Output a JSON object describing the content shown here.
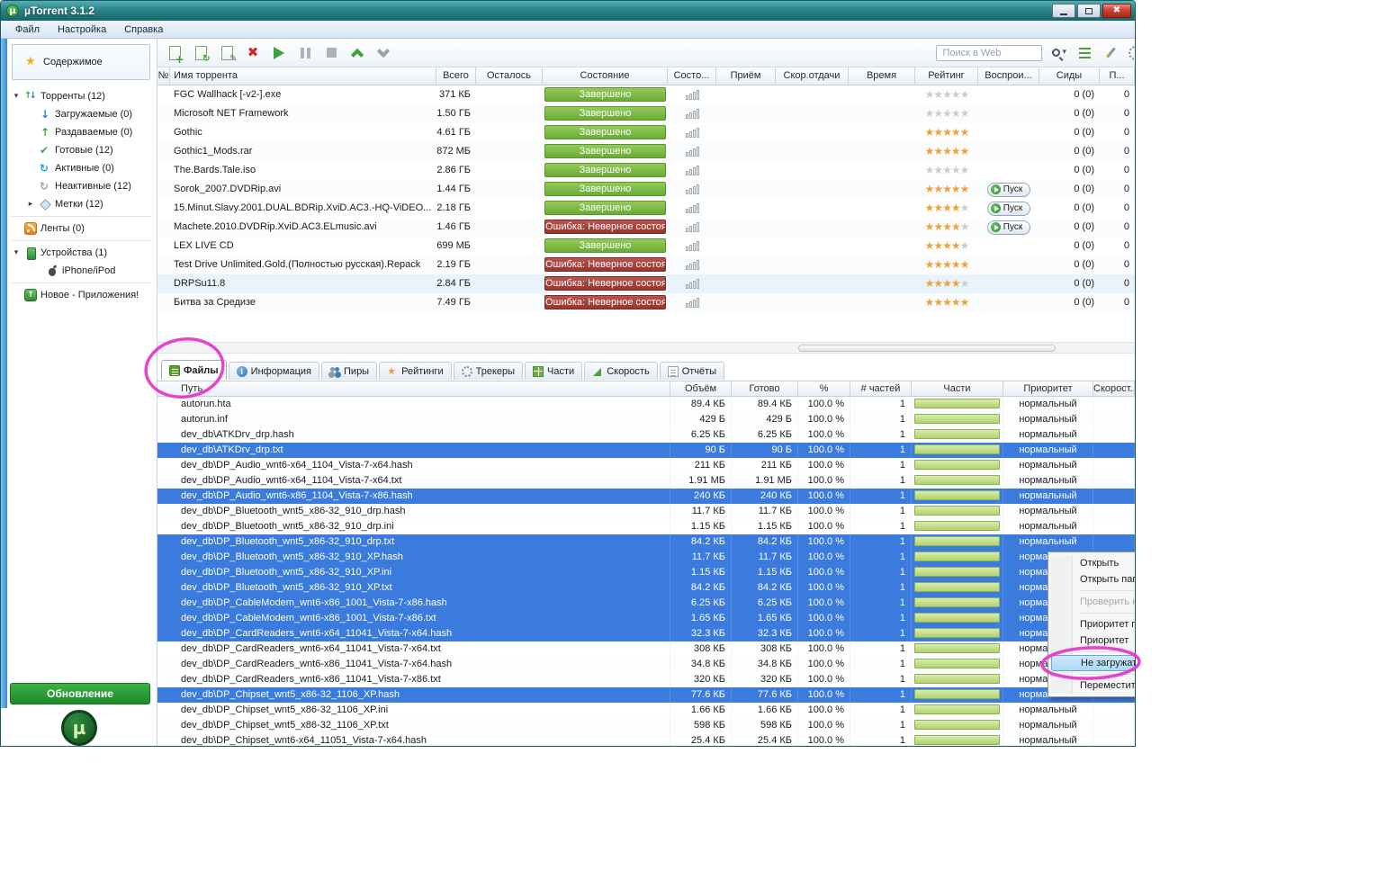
{
  "titlebar": {
    "title": "µTorrent 3.1.2"
  },
  "menubar": {
    "items": [
      {
        "key": "file",
        "label": "Файл"
      },
      {
        "key": "settings",
        "label": "Настройка"
      },
      {
        "key": "help",
        "label": "Справка"
      }
    ]
  },
  "toolbar": {
    "search_placeholder": "Поиск в Web"
  },
  "sidebar": {
    "content_label": "Содержимое",
    "update_button": "Обновление",
    "plus_logo_glyph": "µ",
    "items": [
      {
        "key": "torrents",
        "label": "Торренты (12)",
        "icon": "torrents-icon",
        "indent": 0,
        "expander": "expanded"
      },
      {
        "key": "downloading",
        "label": "Загружаемые (0)",
        "icon": "download-arrow-icon",
        "indent": 1
      },
      {
        "key": "seeding",
        "label": "Раздаваемые (0)",
        "icon": "upload-arrow-icon",
        "indent": 1
      },
      {
        "key": "finished",
        "label": "Готовые (12)",
        "icon": "check-icon",
        "indent": 1
      },
      {
        "key": "active",
        "label": "Активные (0)",
        "icon": "active-arrows-icon",
        "indent": 1
      },
      {
        "key": "inactive",
        "label": "Неактивные (12)",
        "icon": "inactive-arrows-icon",
        "indent": 1
      },
      {
        "key": "labels",
        "label": "Метки (12)",
        "icon": "label-icon",
        "indent": 1,
        "expander": "collapsed"
      },
      {
        "divider": true
      },
      {
        "key": "feeds",
        "label": "Ленты (0)",
        "icon": "rss-icon",
        "indent": 0
      },
      {
        "divider": true
      },
      {
        "key": "devices",
        "label": "Устройства (1)",
        "icon": "device-icon",
        "indent": 0,
        "expander": "expanded"
      },
      {
        "key": "iphone",
        "label": "iPhone/iPod",
        "icon": "apple-icon",
        "indent": 2
      },
      {
        "divider": true
      },
      {
        "key": "apps-promo",
        "label": "Новое - Приложения!",
        "icon": "apps-icon",
        "indent": 0
      }
    ]
  },
  "torrent_table": {
    "columns": [
      "№",
      "Имя торрента",
      "Всего",
      "Осталось",
      "Состояние",
      "Состо...",
      "Приём",
      "Скор.отдачи",
      "Время",
      "Рейтинг",
      "Воспрои...",
      "Сиды",
      "П..."
    ],
    "play_label": "Пуск",
    "rows": [
      {
        "name": "FGC Wallhack [-v2-].exe",
        "size": "371 КБ",
        "status": "Завершено",
        "status_type": "done",
        "rating": 0,
        "play": false,
        "seeds": "0 (0)",
        "p": "0"
      },
      {
        "name": "Microsoft NET Framework",
        "size": "1.50 ГБ",
        "status": "Завершено",
        "status_type": "done",
        "rating": 0,
        "play": false,
        "seeds": "0 (0)",
        "p": "0"
      },
      {
        "name": "Gothic",
        "size": "4.61 ГБ",
        "status": "Завершено",
        "status_type": "done",
        "rating": 5,
        "play": false,
        "seeds": "0 (0)",
        "p": "0"
      },
      {
        "name": "Gothic1_Mods.rar",
        "size": "872 МБ",
        "status": "Завершено",
        "status_type": "done",
        "rating": 5,
        "play": false,
        "seeds": "0 (0)",
        "p": "0"
      },
      {
        "name": "The.Bards.Tale.iso",
        "size": "2.86 ГБ",
        "status": "Завершено",
        "status_type": "done",
        "rating": 0,
        "play": false,
        "seeds": "0 (0)",
        "p": "0"
      },
      {
        "name": "Sorok_2007.DVDRip.avi",
        "size": "1.44 ГБ",
        "status": "Завершено",
        "status_type": "done",
        "rating": 5,
        "play": true,
        "seeds": "0 (0)",
        "p": "0"
      },
      {
        "name": "15.Minut.Slavy.2001.DUAL.BDRip.XviD.AC3.-HQ-ViDEO...",
        "size": "2.18 ГБ",
        "status": "Завершено",
        "status_type": "done",
        "rating": 4,
        "play": true,
        "seeds": "0 (0)",
        "p": "0"
      },
      {
        "name": "Machete.2010.DVDRip.XviD.AC3.ELmusic.avi",
        "size": "1.46 ГБ",
        "status": "Ошибка: Неверное состоя",
        "status_type": "error",
        "rating": 4,
        "play": true,
        "seeds": "0 (0)",
        "p": "0"
      },
      {
        "name": "LEX LIVE CD",
        "size": "699 МБ",
        "status": "Завершено",
        "status_type": "done",
        "rating": 4,
        "play": false,
        "seeds": "0 (0)",
        "p": "0"
      },
      {
        "name": "Test Drive Unlimited.Gold.(Полностью русская).Repack",
        "size": "2.19 ГБ",
        "status": "Ошибка: Неверное состоя",
        "status_type": "error",
        "rating": 5,
        "play": false,
        "seeds": "0 (0)",
        "p": "0"
      },
      {
        "name": "DRPSu11.8",
        "size": "2.84 ГБ",
        "status": "Ошибка: Неверное состоя",
        "status_type": "error",
        "rating": 4,
        "play": false,
        "seeds": "0 (0)",
        "p": "0",
        "hover": true
      },
      {
        "name": "Битва за Средизе",
        "size": "7.49 ГБ",
        "status": "Ошибка: Неверное состоя",
        "status_type": "error",
        "rating": 5,
        "play": false,
        "seeds": "0 (0)",
        "p": "0"
      }
    ]
  },
  "tabs": [
    {
      "key": "files",
      "label": "Файлы",
      "icon": "files-icon",
      "selected": true
    },
    {
      "key": "info",
      "label": "Информация",
      "icon": "info-icon"
    },
    {
      "key": "peers",
      "label": "Пиры",
      "icon": "peers-icon"
    },
    {
      "key": "ratings",
      "label": "Рейтинги",
      "icon": "ratings-icon"
    },
    {
      "key": "trackers",
      "label": "Трекеры",
      "icon": "trackers-icon"
    },
    {
      "key": "pieces",
      "label": "Части",
      "icon": "pieces-icon"
    },
    {
      "key": "speed",
      "label": "Скорость",
      "icon": "speed-icon"
    },
    {
      "key": "reports",
      "label": "Отчёты",
      "icon": "reports-icon"
    }
  ],
  "files_table": {
    "columns": [
      "Путь",
      "Объём",
      "Готово",
      "%",
      "# частей",
      "Части",
      "Приоритет",
      "Скорост..."
    ],
    "rows": [
      {
        "path": "autorun.hta",
        "size": "89.4 КБ",
        "done": "89.4 КБ",
        "pct": "100.0 %",
        "pieces": "1",
        "priority": "нормальный",
        "selected": false
      },
      {
        "path": "autorun.inf",
        "size": "429 Б",
        "done": "429 Б",
        "pct": "100.0 %",
        "pieces": "1",
        "priority": "нормальный",
        "selected": false
      },
      {
        "path": "dev_db\\ATKDrv_drp.hash",
        "size": "6.25 КБ",
        "done": "6.25 КБ",
        "pct": "100.0 %",
        "pieces": "1",
        "priority": "нормальный",
        "selected": false
      },
      {
        "path": "dev_db\\ATKDrv_drp.txt",
        "size": "90 Б",
        "done": "90 Б",
        "pct": "100.0 %",
        "pieces": "1",
        "priority": "нормальный",
        "selected": true
      },
      {
        "path": "dev_db\\DP_Audio_wnt6-x64_1104_Vista-7-x64.hash",
        "size": "211 КБ",
        "done": "211 КБ",
        "pct": "100.0 %",
        "pieces": "1",
        "priority": "нормальный",
        "selected": false
      },
      {
        "path": "dev_db\\DP_Audio_wnt6-x64_1104_Vista-7-x64.txt",
        "size": "1.91 МБ",
        "done": "1.91 МБ",
        "pct": "100.0 %",
        "pieces": "1",
        "priority": "нормальный",
        "selected": false
      },
      {
        "path": "dev_db\\DP_Audio_wnt6-x86_1104_Vista-7-x86.hash",
        "size": "240 КБ",
        "done": "240 КБ",
        "pct": "100.0 %",
        "pieces": "1",
        "priority": "нормальный",
        "selected": true
      },
      {
        "path": "dev_db\\DP_Bluetooth_wnt5_x86-32_910_drp.hash",
        "size": "11.7 КБ",
        "done": "11.7 КБ",
        "pct": "100.0 %",
        "pieces": "1",
        "priority": "нормальный",
        "selected": false
      },
      {
        "path": "dev_db\\DP_Bluetooth_wnt5_x86-32_910_drp.ini",
        "size": "1.15 КБ",
        "done": "1.15 КБ",
        "pct": "100.0 %",
        "pieces": "1",
        "priority": "нормальный",
        "selected": false
      },
      {
        "path": "dev_db\\DP_Bluetooth_wnt5_x86-32_910_drp.txt",
        "size": "84.2 КБ",
        "done": "84.2 КБ",
        "pct": "100.0 %",
        "pieces": "1",
        "priority": "нормальный",
        "selected": true
      },
      {
        "path": "dev_db\\DP_Bluetooth_wnt5_x86-32_910_XP.hash",
        "size": "11.7 КБ",
        "done": "11.7 КБ",
        "pct": "100.0 %",
        "pieces": "1",
        "priority": "нормальный",
        "selected": true
      },
      {
        "path": "dev_db\\DP_Bluetooth_wnt5_x86-32_910_XP.ini",
        "size": "1.15 КБ",
        "done": "1.15 КБ",
        "pct": "100.0 %",
        "pieces": "1",
        "priority": "нормальный",
        "selected": true
      },
      {
        "path": "dev_db\\DP_Bluetooth_wnt5_x86-32_910_XP.txt",
        "size": "84.2 КБ",
        "done": "84.2 КБ",
        "pct": "100.0 %",
        "pieces": "1",
        "priority": "нормальный",
        "selected": true
      },
      {
        "path": "dev_db\\DP_CableModem_wnt6-x86_1001_Vista-7-x86.hash",
        "size": "6.25 КБ",
        "done": "6.25 КБ",
        "pct": "100.0 %",
        "pieces": "1",
        "priority": "нормальный",
        "selected": true
      },
      {
        "path": "dev_db\\DP_CableModem_wnt6-x86_1001_Vista-7-x86.txt",
        "size": "1.65 КБ",
        "done": "1.65 КБ",
        "pct": "100.0 %",
        "pieces": "1",
        "priority": "нормальный",
        "selected": true
      },
      {
        "path": "dev_db\\DP_CardReaders_wnt6-x64_11041_Vista-7-x64.hash",
        "size": "32.3 КБ",
        "done": "32.3 КБ",
        "pct": "100.0 %",
        "pieces": "1",
        "priority": "нормальный",
        "selected": true
      },
      {
        "path": "dev_db\\DP_CardReaders_wnt6-x64_11041_Vista-7-x64.txt",
        "size": "308 КБ",
        "done": "308 КБ",
        "pct": "100.0 %",
        "pieces": "1",
        "priority": "нормальный",
        "selected": false
      },
      {
        "path": "dev_db\\DP_CardReaders_wnt6-x86_11041_Vista-7-x64.hash",
        "size": "34.8 КБ",
        "done": "34.8 КБ",
        "pct": "100.0 %",
        "pieces": "1",
        "priority": "нормальный",
        "selected": false
      },
      {
        "path": "dev_db\\DP_CardReaders_wnt6-x86_11041_Vista-7-x86.txt",
        "size": "320 КБ",
        "done": "320 КБ",
        "pct": "100.0 %",
        "pieces": "1",
        "priority": "нормальный",
        "selected": false
      },
      {
        "path": "dev_db\\DP_Chipset_wnt5_x86-32_1106_XP.hash",
        "size": "77.6 КБ",
        "done": "77.6 КБ",
        "pct": "100.0 %",
        "pieces": "1",
        "priority": "нормальный",
        "selected": true
      },
      {
        "path": "dev_db\\DP_Chipset_wnt5_x86-32_1106_XP.ini",
        "size": "1.66 КБ",
        "done": "1.66 КБ",
        "pct": "100.0 %",
        "pieces": "1",
        "priority": "нормальный",
        "selected": false
      },
      {
        "path": "dev_db\\DP_Chipset_wnt5_x86-32_1106_XP.txt",
        "size": "598 КБ",
        "done": "598 КБ",
        "pct": "100.0 %",
        "pieces": "1",
        "priority": "нормальный",
        "selected": false
      },
      {
        "path": "dev_db\\DP_Chipset_wnt6-x64_11051_Vista-7-x64.hash",
        "size": "25.4 КБ",
        "done": "25.4 КБ",
        "pct": "100.0 %",
        "pieces": "1",
        "priority": "нормальный",
        "selected": false
      }
    ]
  },
  "context_menu": {
    "items": [
      {
        "key": "open",
        "label": "Открыть"
      },
      {
        "key": "open-folder",
        "label": "Открыть папку"
      },
      {
        "divider": true
      },
      {
        "key": "antivirus-check",
        "label": "Проверить на вир",
        "disabled": true
      },
      {
        "divider": true
      },
      {
        "key": "priority-by-order",
        "label": "Приоритет по пор"
      },
      {
        "key": "priority",
        "label": "Приоритет"
      },
      {
        "divider": true
      },
      {
        "key": "dont-download",
        "label": "Не загружать",
        "highlighted": true
      },
      {
        "divider": true
      },
      {
        "key": "relocate",
        "label": "Переместить..."
      }
    ]
  },
  "colors": {
    "titlebar_teal": "#2a8489",
    "status_done_green": "#76b043",
    "status_error_red": "#a93b38",
    "selection_blue": "#3b7bdd",
    "pieces_bar_green": "#b2d36e",
    "update_button_green": "#27962e",
    "star_gold": "#f0a13c",
    "annotation_magenta": "#e438cc"
  }
}
